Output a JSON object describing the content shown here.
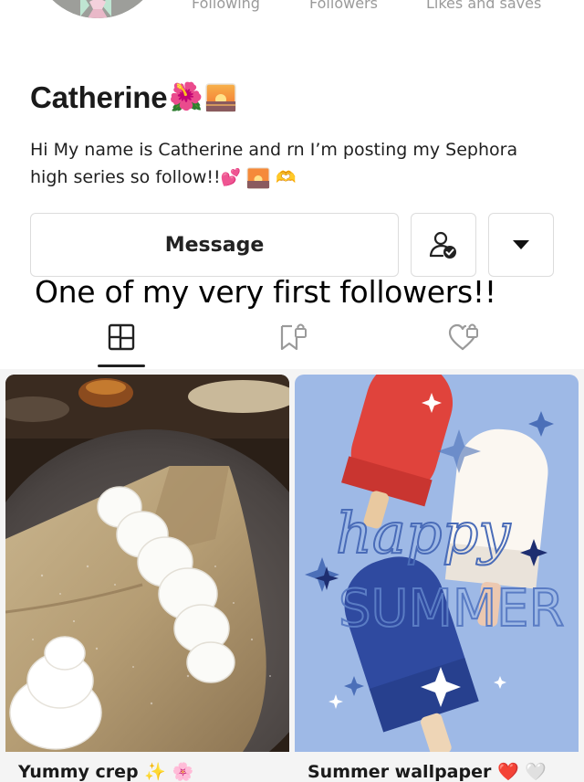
{
  "profile": {
    "name": "Catherine",
    "name_emojis": [
      "🌺",
      "🌅"
    ],
    "bio_line1": "Hi My name is Catherine and rn I’m posting my Sephora",
    "bio_line2": "high series so follow!!",
    "bio_emojis": [
      "💕",
      "🌅",
      "🫶"
    ]
  },
  "stats": {
    "following_label": "Following",
    "followers_label": "Followers",
    "likes_label": "Likes and saves"
  },
  "actions": {
    "message_label": "Message",
    "follow_icon": "user-check-icon",
    "more_icon": "caret-down-icon"
  },
  "overlay_caption": "One of my very first followers!!",
  "tabs": [
    {
      "name": "notes",
      "icon": "grid-icon",
      "active": true
    },
    {
      "name": "saved",
      "icon": "locked-bookmark-icon",
      "active": false
    },
    {
      "name": "liked",
      "icon": "locked-heart-icon",
      "active": false
    }
  ],
  "posts": [
    {
      "title": "Yummy crep",
      "title_emojis": "✨ 🌸",
      "image": "crepe-with-whipped-cream"
    },
    {
      "title": "Summer wallpaper",
      "title_emojis": "❤️ 🤍",
      "image": "happy-summer-popsicles"
    }
  ]
}
